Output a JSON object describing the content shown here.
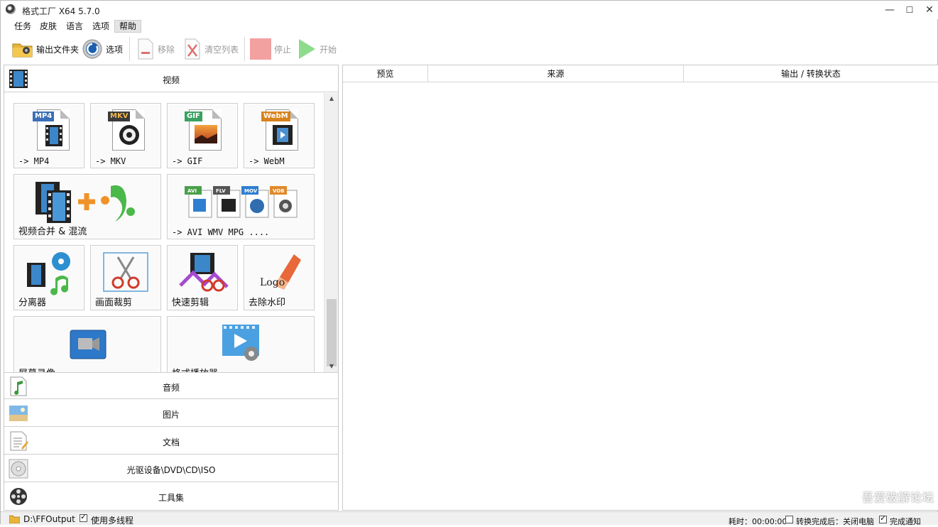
{
  "window": {
    "title": "格式工厂 X64 5.7.0",
    "min": "—",
    "max": "☐",
    "close": "✕"
  },
  "menu": [
    {
      "label": "任务"
    },
    {
      "label": "皮肤"
    },
    {
      "label": "语言"
    },
    {
      "label": "选项"
    },
    {
      "label": "帮助",
      "active": true
    }
  ],
  "toolbar": {
    "output_folder": "输出文件夹",
    "options": "选项",
    "remove": "移除",
    "clear_list": "清空列表",
    "stop": "停止",
    "start": "开始"
  },
  "categories": {
    "video": "视频",
    "audio": "音频",
    "image": "图片",
    "document": "文档",
    "disc": "光驱设备\\DVD\\CD\\ISO",
    "tools": "工具集"
  },
  "video_tiles": {
    "mp4": {
      "label": "-> MP4",
      "tag": "MP4",
      "tag_color": "#3b6fb6"
    },
    "mkv": {
      "label": "-> MKV",
      "tag": "MKV",
      "tag_color": "#3a3a3a"
    },
    "gif": {
      "label": "-> GIF",
      "tag": "GIF",
      "tag_color": "#3aa160"
    },
    "webm": {
      "label": "-> WebM",
      "tag": "WebM",
      "tag_color": "#d9821c"
    },
    "merge": {
      "label": "视频合并 & 混流"
    },
    "others": {
      "label": "-> AVI WMV MPG ....",
      "tags": [
        "AVI",
        "FLV",
        "MOV",
        "VOB"
      ]
    },
    "splitter": {
      "label": "分离器"
    },
    "crop": {
      "label": "画面裁剪"
    },
    "quick_cut": {
      "label": "快速剪辑"
    },
    "remove_logo": {
      "label": "去除水印",
      "logo_text": "Logo"
    },
    "screen_record": {
      "label": "屏幕录像"
    },
    "player": {
      "label": "格式播放器"
    }
  },
  "table": {
    "columns": [
      "预览",
      "来源",
      "输出 / 转换状态"
    ]
  },
  "status": {
    "output_path": "D:\\FFOutput",
    "multithread": "使用多线程",
    "elapsed": "耗时：00:00:00",
    "after_convert": "转换完成后：关闭电脑",
    "notify": "完成通知",
    "watermark": "吾爱破解论坛"
  },
  "colors": {
    "accent_select": "#e5e5e5",
    "border": "#c9c9c9",
    "stop_red": "#f08080",
    "start_green": "#5fcf5f"
  }
}
